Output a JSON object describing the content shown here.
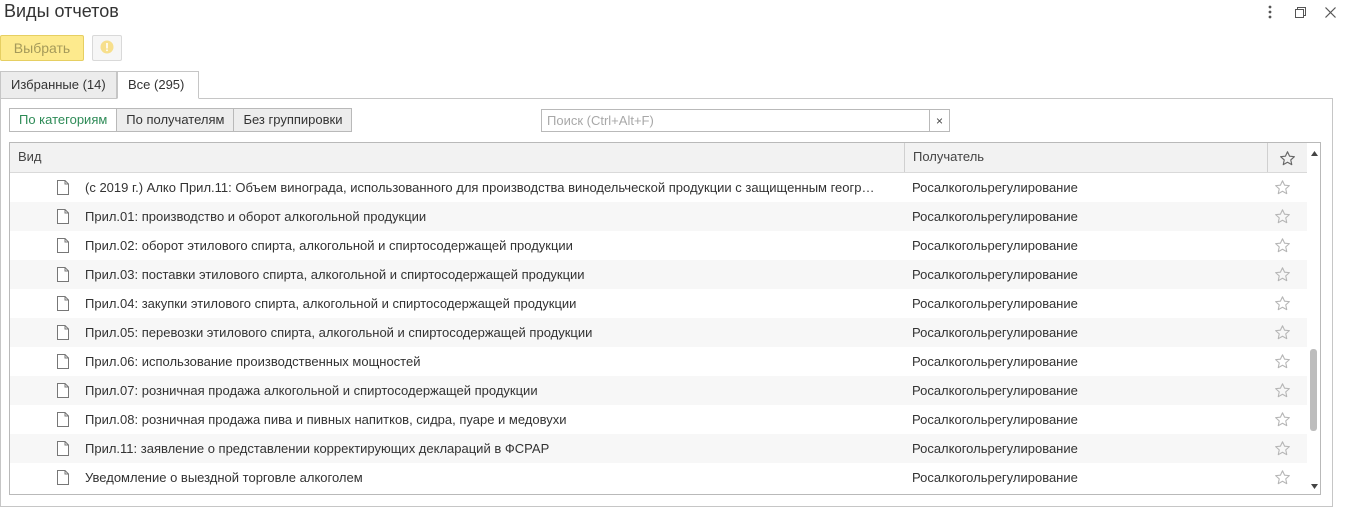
{
  "window": {
    "title": "Виды отчетов"
  },
  "toolbar": {
    "select_label": "Выбрать"
  },
  "tabs": [
    {
      "label": "Избранные (14)"
    },
    {
      "label": "Все (295)"
    }
  ],
  "grouping": [
    {
      "label": "По категориям",
      "active": true
    },
    {
      "label": "По получателям",
      "active": false
    },
    {
      "label": "Без группировки",
      "active": false
    }
  ],
  "search": {
    "placeholder": "Поиск (Ctrl+Alt+F)",
    "clear_label": "×"
  },
  "table": {
    "columns": [
      "Вид",
      "Получатель"
    ],
    "rows": [
      {
        "name": "(с 2019 г.) Алко Прил.11: Объем винограда, использованного для производства винодельческой продукции с защищенным геогр…",
        "recipient": "Росалкогольрегулирование"
      },
      {
        "name": "Прил.01: производство и оборот алкогольной продукции",
        "recipient": "Росалкогольрегулирование"
      },
      {
        "name": "Прил.02: оборот этилового спирта, алкогольной и спиртосодержащей продукции",
        "recipient": "Росалкогольрегулирование"
      },
      {
        "name": "Прил.03: поставки этилового спирта, алкогольной и спиртосодержащей продукции",
        "recipient": "Росалкогольрегулирование"
      },
      {
        "name": "Прил.04: закупки этилового спирта, алкогольной и спиртосодержащей продукции",
        "recipient": "Росалкогольрегулирование"
      },
      {
        "name": "Прил.05: перевозки этилового спирта, алкогольной и спиртосодержащей продукции",
        "recipient": "Росалкогольрегулирование"
      },
      {
        "name": "Прил.06: использование производственных мощностей",
        "recipient": "Росалкогольрегулирование"
      },
      {
        "name": "Прил.07: розничная продажа алкогольной и спиртосодержащей продукции",
        "recipient": "Росалкогольрегулирование"
      },
      {
        "name": "Прил.08: розничная продажа пива и пивных напитков, сидра, пуаре и медовухи",
        "recipient": "Росалкогольрегулирование"
      },
      {
        "name": "Прил.11: заявление о представлении корректирующих деклараций в ФСРАР",
        "recipient": "Росалкогольрегулирование"
      },
      {
        "name": "Уведомление о выездной торговле алкоголем",
        "recipient": "Росалкогольрегулирование"
      }
    ]
  },
  "icons": {
    "window_menu": "more-vertical-icon",
    "window_restore": "restore-icon",
    "window_close": "close-icon",
    "info": "info-icon",
    "row": "document-icon",
    "favorite": "star-outline-icon"
  },
  "colors": {
    "select_button_bg": "#fdea8d",
    "active_group_text": "#2e8b57",
    "info_icon": "#f3d36b"
  }
}
